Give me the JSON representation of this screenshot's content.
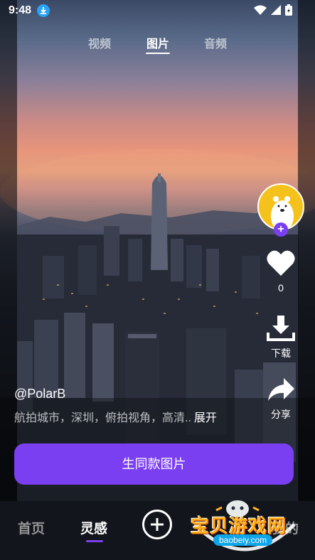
{
  "status_bar": {
    "time": "9:48"
  },
  "top_tabs": [
    {
      "label": "视频",
      "active": false
    },
    {
      "label": "图片",
      "active": true
    },
    {
      "label": "音频",
      "active": false
    }
  ],
  "actions": {
    "like_count": "0",
    "download_label": "下载",
    "share_label": "分享"
  },
  "post": {
    "username": "@PolarB",
    "description": "航拍城市，深圳，俯拍视角，高清..",
    "expand_label": "展开"
  },
  "cta": {
    "label": "生同款图片"
  },
  "bottom_nav": {
    "items": [
      {
        "label": "首页",
        "active": false
      },
      {
        "label": "灵感",
        "active": true
      },
      {
        "label": "我的",
        "active": false
      }
    ]
  },
  "watermark": {
    "text": "宝贝游戏网",
    "url": "baobeiy.com"
  },
  "colors": {
    "accent": "#7b3ff2",
    "avatar_bg": "#f5c21b",
    "download_badge": "#2aa3f5"
  }
}
